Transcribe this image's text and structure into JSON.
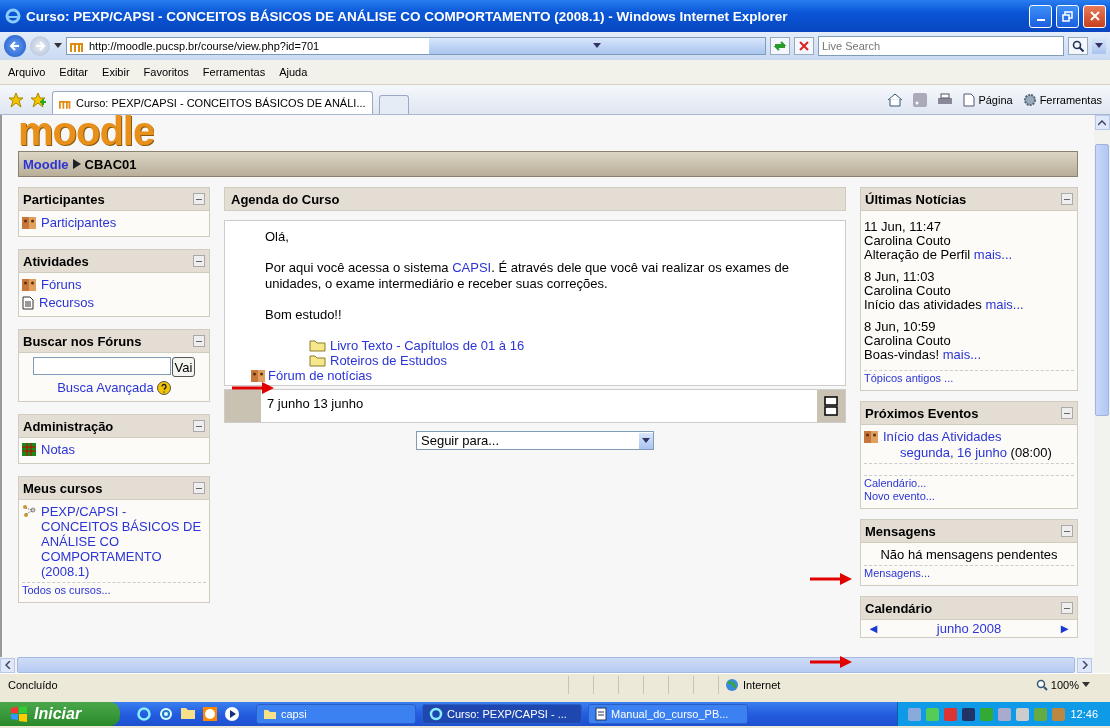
{
  "window": {
    "title": "Curso: PEXP/CAPSI - CONCEITOS BÁSICOS DE ANÁLISE CO COMPORTAMENTO (2008.1) - Windows Internet Explorer"
  },
  "address_bar": {
    "url": "http://moodle.pucsp.br/course/view.php?id=701",
    "search_placeholder": "Live Search"
  },
  "menu": [
    "Arquivo",
    "Editar",
    "Exibir",
    "Favoritos",
    "Ferramentas",
    "Ajuda"
  ],
  "tabs": [
    {
      "label": "Curso: PEXP/CAPSI - CONCEITOS BÁSICOS DE ANÁLI...",
      "selected": true
    }
  ],
  "command_bar": [
    "Página",
    "Ferramentas"
  ],
  "page": {
    "logo": "moodle",
    "breadcrumb": [
      "Moodle",
      "CBAC01"
    ],
    "left_blocks": [
      {
        "title": "Participantes",
        "kind": "links",
        "items": [
          {
            "kind": "forum",
            "text": "Participantes"
          }
        ]
      },
      {
        "title": "Atividades",
        "kind": "links",
        "items": [
          {
            "kind": "forum",
            "text": "Fóruns"
          },
          {
            "kind": "resource",
            "text": "Recursos"
          }
        ]
      },
      {
        "title": "Buscar nos Fóruns",
        "kind": "search",
        "button": "Vai",
        "link": "Busca Avançada"
      },
      {
        "title": "Administração",
        "kind": "links",
        "items": [
          {
            "kind": "grades",
            "text": "Notas"
          }
        ]
      },
      {
        "title": "Meus cursos",
        "kind": "courses",
        "items": [
          {
            "kind": "course",
            "text": "PEXP/CAPSI - CONCEITOS BÁSICOS DE ANÁLISE CO COMPORTAMENTO (2008.1)"
          }
        ],
        "footer": [
          "Todos os cursos..."
        ]
      }
    ],
    "center": {
      "title": "Agenda do Curso",
      "greeting": "Olá,",
      "intro": {
        "before": "Por aqui você acessa o sistema ",
        "link": "CAPSI",
        "after": ". É através dele que você vai realizar os exames de unidades, o exame intermediário e receber suas correções."
      },
      "closing": "Bom estudo!!",
      "resources": [
        {
          "kind": "folder",
          "text": "Livro Texto - Capítulos de 01 à 16"
        },
        {
          "kind": "folder",
          "text": "Roteiros de Estudos"
        }
      ],
      "forum": "Fórum de notícias",
      "week": "7 junho 13 junho",
      "jump": "Seguir para..."
    },
    "right_blocks": [
      {
        "title": "Últimas Notícias",
        "kind": "news",
        "entries": [
          {
            "date": "11 Jun, 11:47",
            "author": "Carolina Couto",
            "text": "Alteração de Perfil",
            "more": "mais..."
          },
          {
            "date": "8 Jun, 11:03",
            "author": "Carolina Couto",
            "text": "Início das atividades",
            "more": "mais..."
          },
          {
            "date": "8 Jun, 10:59",
            "author": "Carolina Couto",
            "text": "Boas-vindas!",
            "more": "mais..."
          }
        ],
        "footer": [
          "Tópicos antigos ..."
        ]
      },
      {
        "title": "Próximos Eventos",
        "kind": "events",
        "entries": [
          {
            "title": "Início das Atividades",
            "when": "segunda, 16 junho",
            "time": "(08:00)"
          }
        ],
        "footer": [
          "Calendário...",
          "Novo evento..."
        ]
      },
      {
        "title": "Mensagens",
        "kind": "messages",
        "text": "Não há mensagens pendentes",
        "footer": [
          "Mensagens..."
        ]
      },
      {
        "title": "Calendário",
        "kind": "calendar",
        "prev": "◄",
        "month": "junho 2008",
        "next": "►"
      }
    ]
  },
  "status_bar": {
    "text": "Concluído",
    "zone": "Internet",
    "zoom": "100%"
  },
  "taskbar": {
    "start": "Iniciar",
    "tasks": [
      {
        "label": "capsi",
        "kind": "folder",
        "selected": false
      },
      {
        "label": "Curso: PEXP/CAPSI - ...",
        "kind": "browser",
        "selected": true
      },
      {
        "label": "Manual_do_curso_PB...",
        "kind": "document",
        "selected": false
      }
    ],
    "clock": "12:46"
  }
}
